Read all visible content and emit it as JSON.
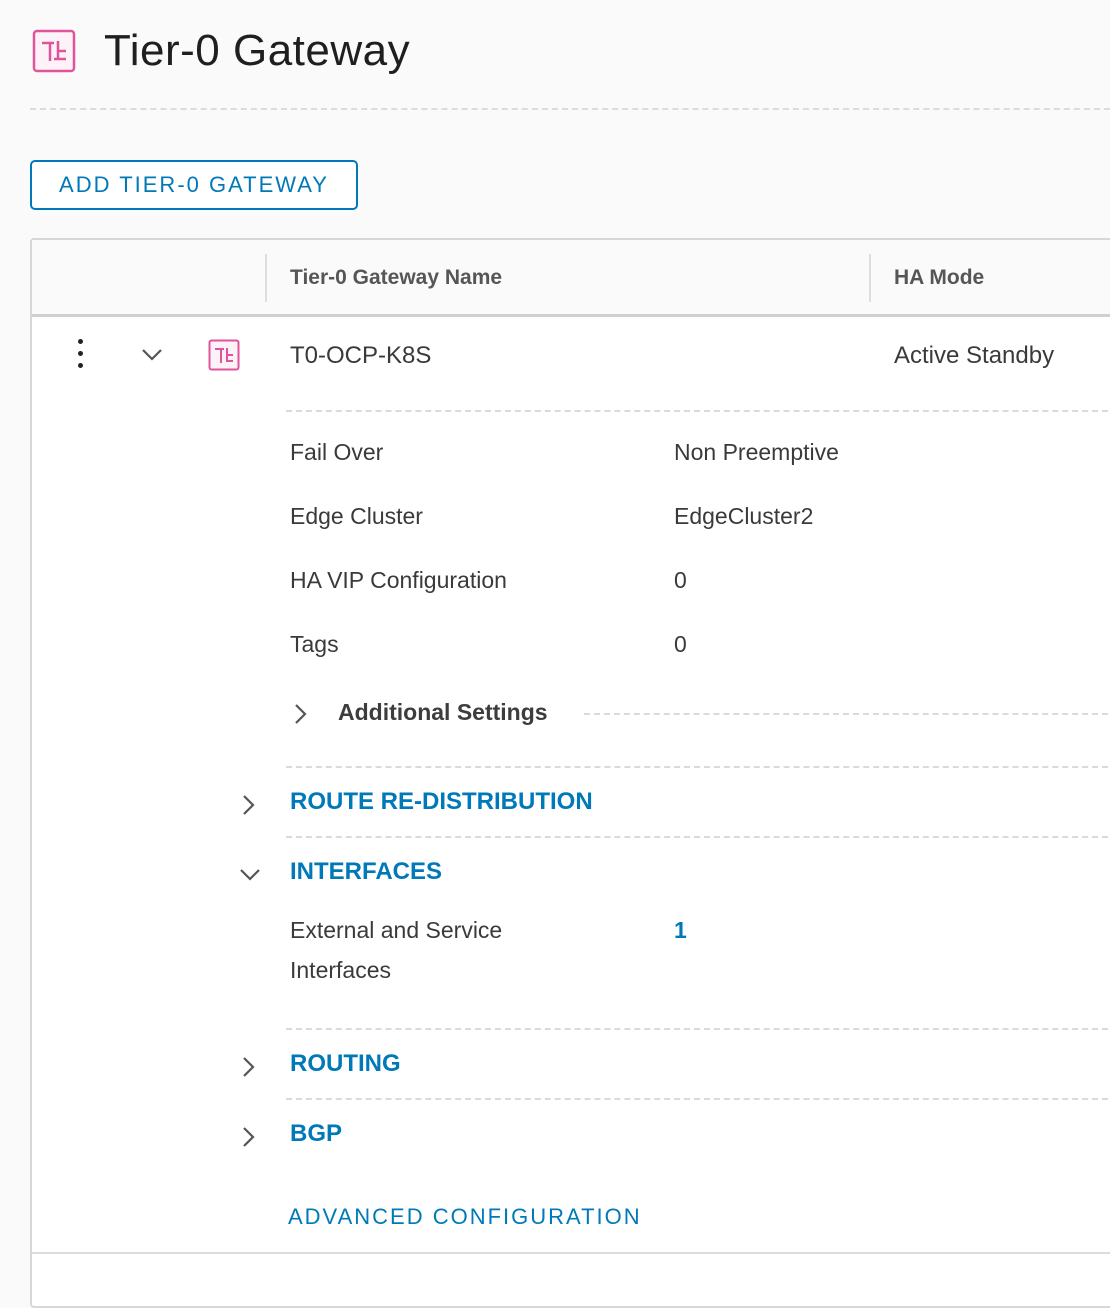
{
  "page": {
    "title": "Tier-0 Gateway",
    "icon": "tier0-gateway-icon"
  },
  "toolbar": {
    "add_label": "ADD TIER-0 GATEWAY"
  },
  "grid": {
    "columns": [
      {
        "label": "Tier-0 Gateway Name"
      },
      {
        "label": "HA Mode"
      }
    ],
    "row": {
      "name": "T0-OCP-K8S",
      "ha_mode": "Active Standby",
      "icon": "tier0-gateway-icon",
      "details": [
        {
          "label": "Fail Over",
          "value": "Non Preemptive"
        },
        {
          "label": "Edge Cluster",
          "value": "EdgeCluster2"
        },
        {
          "label": "HA VIP Configuration",
          "value": "0"
        },
        {
          "label": "Tags",
          "value": "0"
        }
      ],
      "additional_settings": "Additional Settings",
      "sections": {
        "route_redistribution": "ROUTE RE-DISTRIBUTION",
        "interfaces": "INTERFACES",
        "interfaces_label": "External and Service Interfaces",
        "interfaces_value": "1",
        "routing": "ROUTING",
        "bgp": "BGP"
      },
      "advanced_configuration": "ADVANCED CONFIGURATION"
    }
  },
  "colors": {
    "accent": "#0079b8",
    "icon_pink": "#e0559a"
  }
}
